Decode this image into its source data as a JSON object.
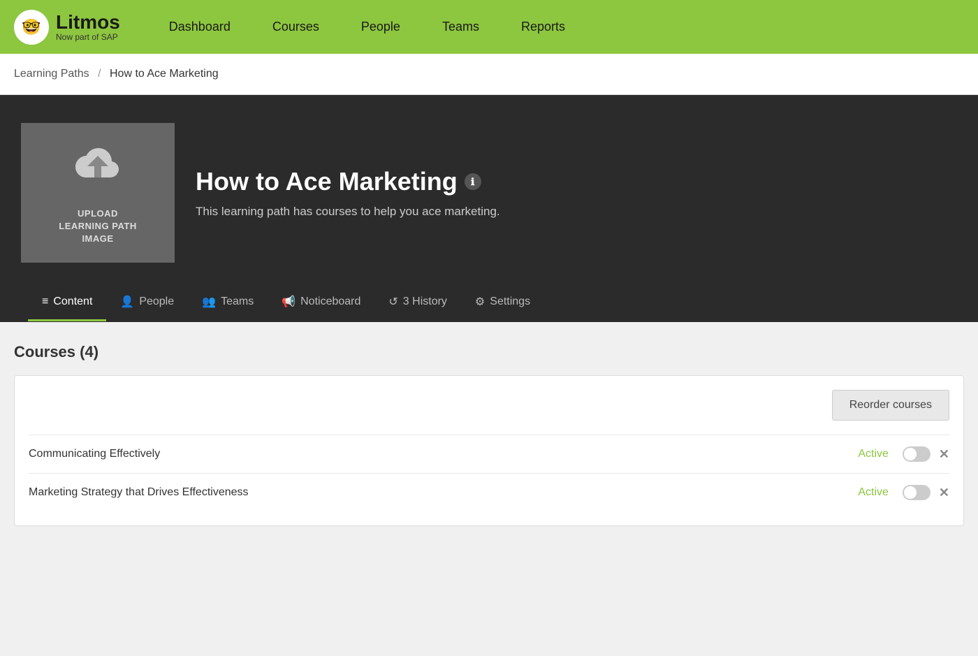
{
  "nav": {
    "logo_title": "Litmos",
    "logo_sub": "Now part of SAP",
    "logo_icon": "🤓",
    "links": [
      {
        "label": "Dashboard",
        "name": "dashboard"
      },
      {
        "label": "Courses",
        "name": "courses"
      },
      {
        "label": "People",
        "name": "people"
      },
      {
        "label": "Teams",
        "name": "teams"
      },
      {
        "label": "Reports",
        "name": "reports"
      }
    ]
  },
  "breadcrumb": {
    "parent_label": "Learning Paths",
    "separator": "/",
    "current_label": "How to Ace Marketing"
  },
  "hero": {
    "upload_label": "UPLOAD\nLEARNING PATH\nIMAGE",
    "title": "How to Ace Marketing",
    "info_icon": "ℹ",
    "description": "This learning path has courses to help you ace marketing."
  },
  "tabs": [
    {
      "label": "Content",
      "icon": "≡",
      "active": true,
      "name": "content"
    },
    {
      "label": "People",
      "icon": "👤",
      "active": false,
      "name": "people"
    },
    {
      "label": "Teams",
      "icon": "👥",
      "active": false,
      "name": "teams"
    },
    {
      "label": "Noticeboard",
      "icon": "📢",
      "active": false,
      "name": "noticeboard"
    },
    {
      "label": "3 History",
      "icon": "↺",
      "active": false,
      "name": "history"
    },
    {
      "label": "Settings",
      "icon": "⚙",
      "active": false,
      "name": "settings"
    }
  ],
  "courses_section": {
    "header": "Courses (4)",
    "reorder_label": "Reorder courses",
    "courses": [
      {
        "name": "Communicating Effectively",
        "status": "Active"
      },
      {
        "name": "Marketing Strategy that Drives Effectiveness",
        "status": "Active"
      }
    ]
  }
}
